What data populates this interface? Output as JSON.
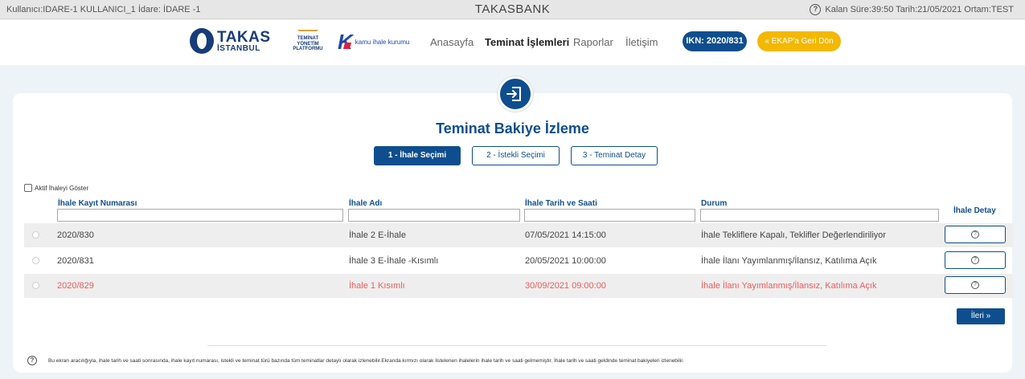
{
  "topbar": {
    "user_info": "Kullanıcı:IDARE-1 KULLANICI_1  İdare: İDARE -1",
    "brand": "TAKASBANK",
    "session_info": "Kalan Süre:39:50  Tarih:21/05/2021  Ortam:TEST"
  },
  "logos": {
    "takas_line1": "TAKAS",
    "takas_line2": "İSTANBUL",
    "typ_line1": "TEMİNAT",
    "typ_line2": "YÖNETİM PLATFORMU",
    "kik_text": "kamu ihale kurumu"
  },
  "nav": {
    "home": "Anasayfa",
    "guarantee_ops": "Teminat İşlemleri",
    "reports": "Raporlar",
    "contact": "İletişim",
    "ikn": "IKN: 2020/831",
    "ekap_back": "« EKAP'a Geri Dön"
  },
  "page": {
    "title": "Teminat Bakiye İzleme",
    "steps": [
      "1 - İhale Seçimi",
      "2 - İstekli Seçimi",
      "3 - Teminat Detay"
    ],
    "active_checkbox_label": "Aktif İhaleyi Göster",
    "next_button": "İleri »",
    "info_text": "Bu ekran aracılığıyla, ihale tarih ve saati sonrasında, ihale kayıt numarası, istekli ve teminat türü bazında tüm teminatlar detaylı olarak izlenebilir.Ekranda kırmızı olarak listelenen ihalelerin ihale tarih ve saati gelmemiştir. İhale tarih ve saati geldinde teminat bakiyeleri izlenebilir."
  },
  "table": {
    "headers": [
      "İhale Kayıt Numarası",
      "İhale Adı",
      "İhale Tarih ve Saati",
      "Durum",
      "İhale Detay"
    ],
    "rows": [
      {
        "no": "2020/830",
        "name": "İhale 2 E-İhale",
        "date": "07/05/2021 14:15:00",
        "status": "İhale Tekliflere Kapalı, Teklifler Değerlendiriliyor"
      },
      {
        "no": "2020/831",
        "name": "İhale 3 E-İhale -Kısımlı",
        "date": "20/05/2021 10:00:00",
        "status": "İhale İlanı Yayımlanmış/İlansız, Katılıma Açık"
      },
      {
        "no": "2020/829",
        "name": "İhale 1 Kısımlı",
        "date": "30/09/2021 09:00:00",
        "status": "İhale İlanı Yayımlanmış/İlansız, Katılıma Açık"
      }
    ]
  },
  "colors": {
    "primary": "#0f4e8e",
    "accent": "#f3b800",
    "future_row": "#f25a5a"
  }
}
